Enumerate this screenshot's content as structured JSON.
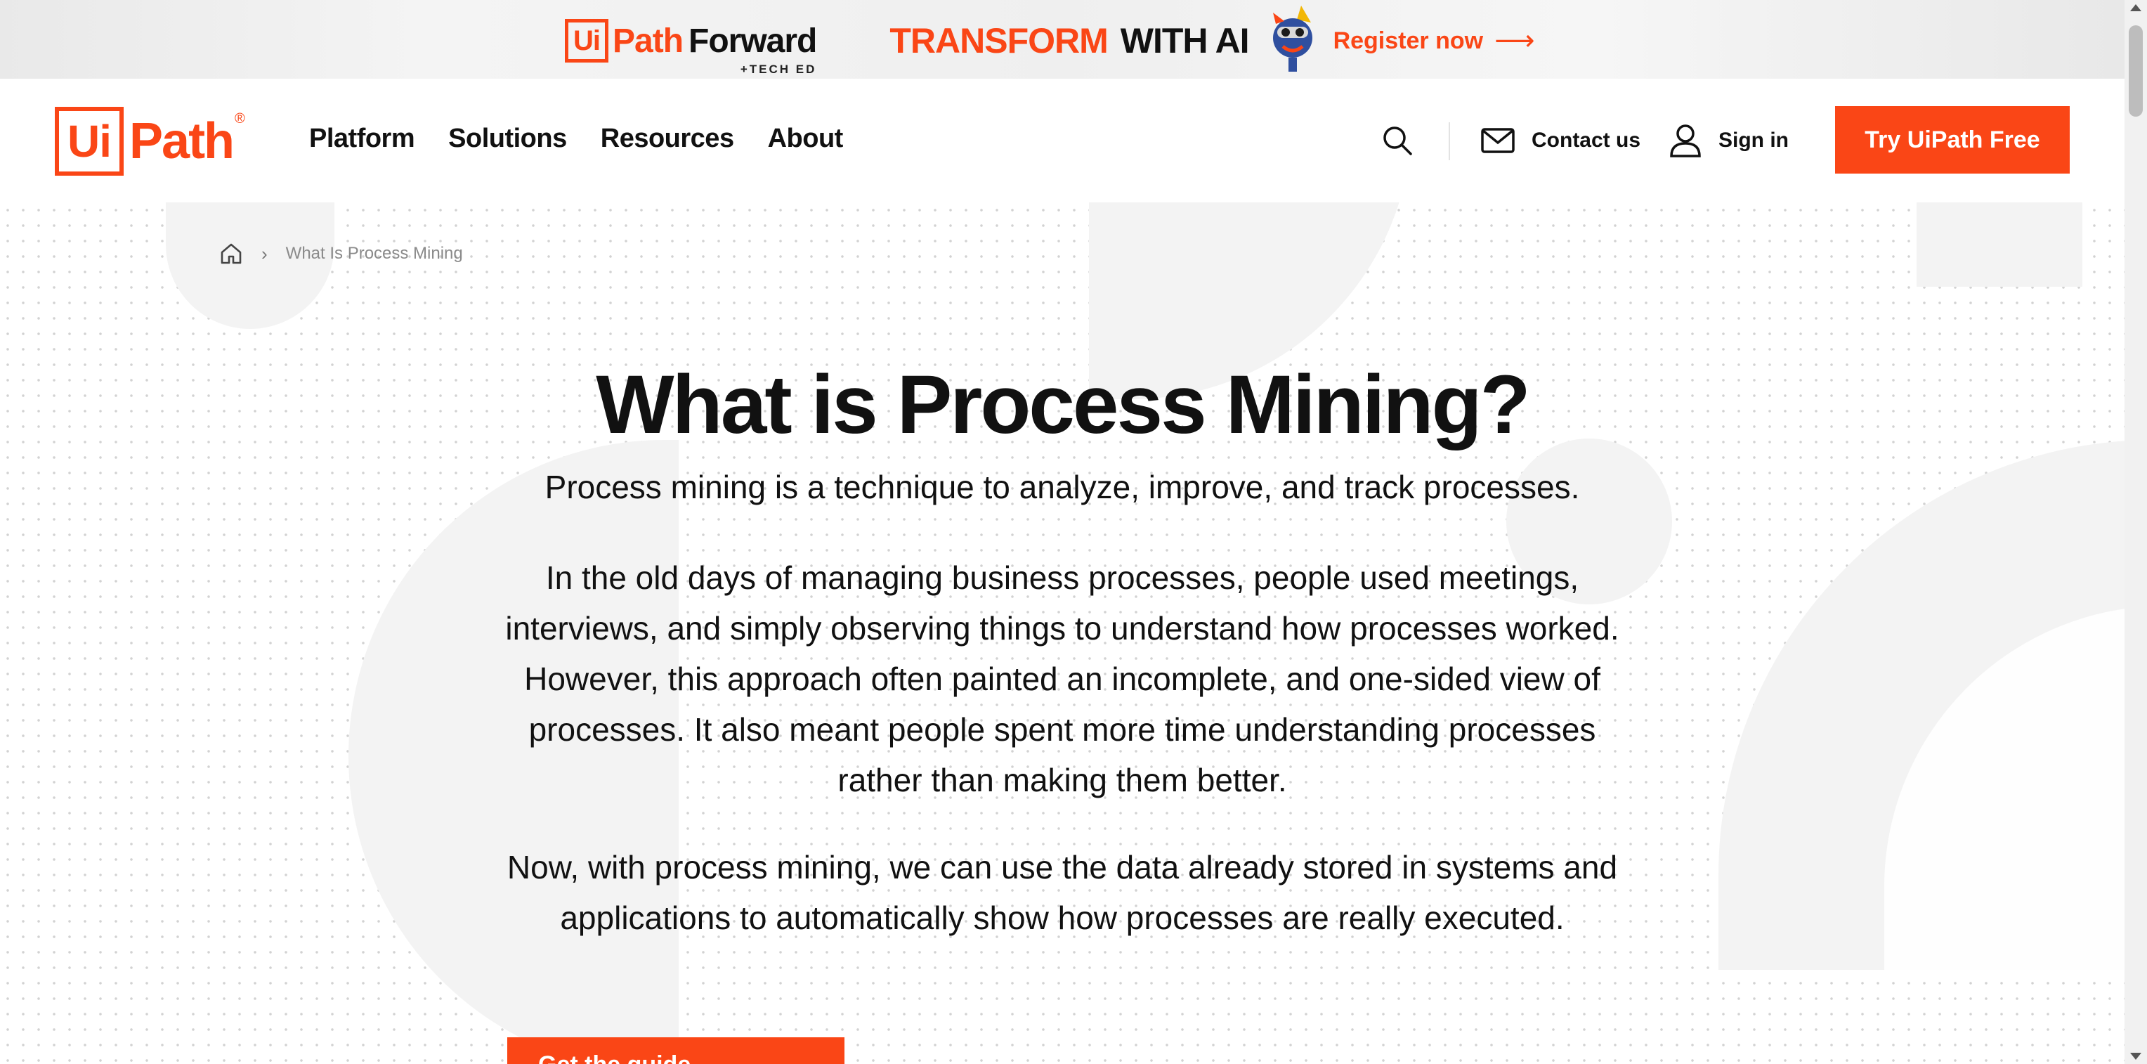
{
  "colors": {
    "brand": "#fa4616",
    "text": "#111111",
    "muted": "#8a8a8a"
  },
  "promo": {
    "brand_ui": "Ui",
    "brand_path": "Path",
    "brand_forward": "Forward",
    "tech_ed": "+TECH ED",
    "transform": "TRANSFORM",
    "with_ai": "WITH AI",
    "register": "Register now",
    "arrow": "⟶"
  },
  "header": {
    "logo_ui": "Ui",
    "logo_path": "Path",
    "logo_reg": "®",
    "nav": [
      "Platform",
      "Solutions",
      "Resources",
      "About"
    ],
    "contact": "Contact us",
    "signin": "Sign in",
    "try": "Try UiPath Free"
  },
  "breadcrumb": {
    "separator": "›",
    "current": "What Is Process Mining"
  },
  "main": {
    "title": "What is Process Mining?",
    "lead": "Process mining is a technique to analyze, improve, and track processes.",
    "para1": "In the old days of managing business processes, people used meetings, interviews, and simply observing things to understand how processes worked. However, this approach often painted an incomplete, and one-sided view of processes. It also meant people spent more time understanding processes rather than making them better.",
    "para2": "Now, with process mining, we can use the data already stored in systems and applications to automatically show how processes are really executed.",
    "cta": "Get the guide"
  }
}
